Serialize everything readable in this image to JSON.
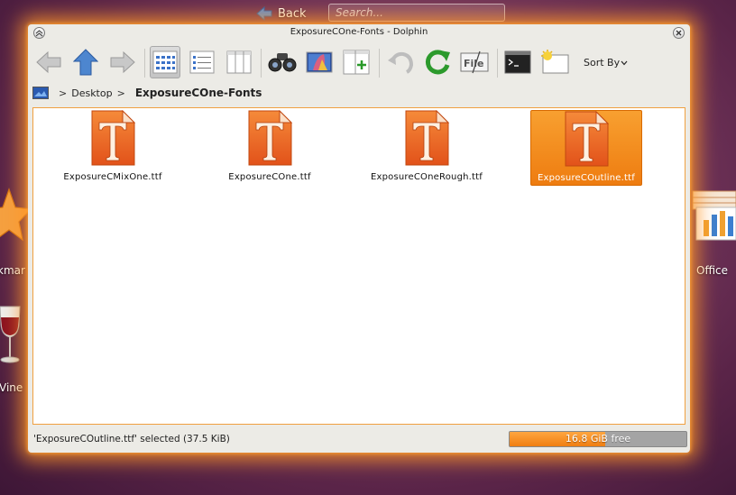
{
  "desktop": {
    "back_label": "Back",
    "search_placeholder": "Search...",
    "left_icons": [
      {
        "label": "kmar",
        "icon": "star-icon"
      },
      {
        "label": "Vine",
        "icon": "wine-glass-icon"
      }
    ],
    "right_icon": {
      "label": "Office",
      "icon": "office-chart-icon"
    }
  },
  "window": {
    "title": "ExposureCOne-Fonts - Dolphin",
    "sort_label": "Sort By",
    "breadcrumb": [
      "Desktop"
    ],
    "current_folder": "ExposureCOne-Fonts",
    "files": [
      {
        "name": "ExposureCMixOne.ttf",
        "selected": false
      },
      {
        "name": "ExposureCOne.ttf",
        "selected": false
      },
      {
        "name": "ExposureCOneRough.ttf",
        "selected": false
      },
      {
        "name": "ExposureCOutline.ttf",
        "selected": true
      }
    ],
    "status_text": "'ExposureCOutline.ttf' selected (37.5 KiB)",
    "free_space_text": "16.8 GiB free",
    "free_space_used_fraction": 0.54
  },
  "colors": {
    "accent": "#f07e10",
    "window_glow": "#ff9628",
    "desktop_bg": "#7d3d63"
  }
}
